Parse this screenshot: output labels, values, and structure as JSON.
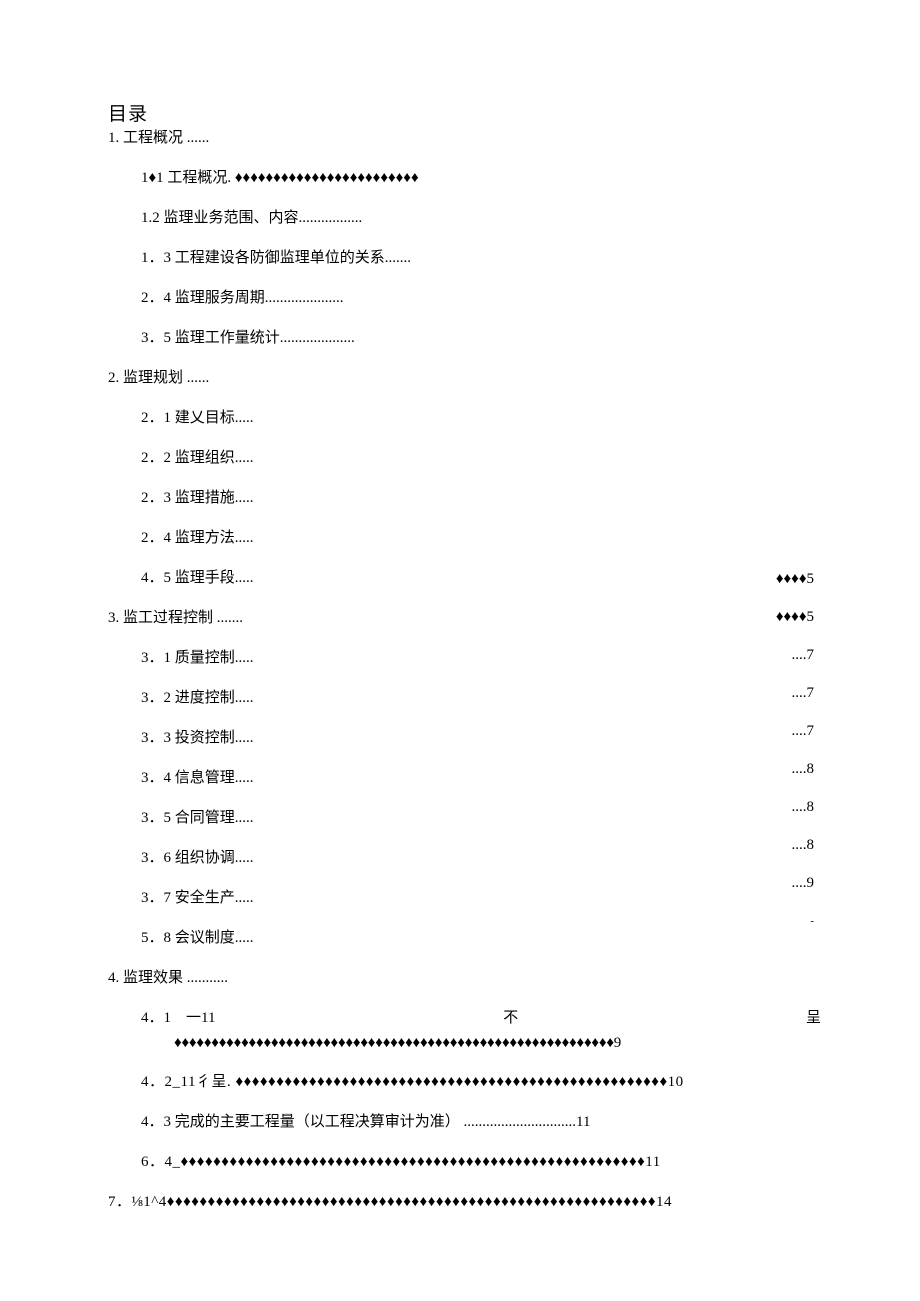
{
  "title": "目录",
  "s1": {
    "label": "1. 工程概况 ......"
  },
  "s1_1": {
    "label": "1♦1 工程概况. ♦♦♦♦♦♦♦♦♦♦♦♦♦♦♦♦♦♦♦♦♦♦♦♦"
  },
  "s1_2": {
    "label": "1.2 监理业务范围、内容................."
  },
  "s1_3": {
    "label": "1．3 工程建设各防御监理单位的关系......."
  },
  "s2_4": {
    "label": "2．4 监理服务周期....................."
  },
  "s3_5": {
    "label": "3．5 监理工作量统计...................."
  },
  "s2": {
    "label": "2. 监理规划 ......"
  },
  "s2_1": {
    "label": "2．1 建乂目标....."
  },
  "s2_2": {
    "label": "2．2 监理组织....."
  },
  "s2_3": {
    "label": "2．3 监理措施....."
  },
  "s2_4b": {
    "label": "2．4 监理方法....."
  },
  "s4_5": {
    "label": "4．5 监理手段....."
  },
  "s3": {
    "label": "3. 监工过程控制 ......."
  },
  "s3_1": {
    "label": "3．1 质量控制....."
  },
  "s3_2": {
    "label": "3．2 进度控制....."
  },
  "s3_3": {
    "label": "3．3 投资控制....."
  },
  "s3_4": {
    "label": "3．4 信息管理....."
  },
  "s3_5b": {
    "label": "3．5 合同管理....."
  },
  "s3_6": {
    "label": "3．6 组织协调....."
  },
  "s3_7": {
    "label": "3．7 安全生产....."
  },
  "s5_8": {
    "label": "5．8 会议制度....."
  },
  "s4": {
    "label": "4. 监理效果 ..........."
  },
  "s4_1a": {
    "a": "4．1　一11",
    "b": "不",
    "c": "呈"
  },
  "s4_1b": {
    "label": "♦♦♦♦♦♦♦♦♦♦♦♦♦♦♦♦♦♦♦♦♦♦♦♦♦♦♦♦♦♦♦♦♦♦♦♦♦♦♦♦♦♦♦♦♦♦♦♦♦♦♦♦♦♦♦♦♦♦♦9"
  },
  "s4_2": {
    "label": "4．2_11彳呈. ♦♦♦♦♦♦♦♦♦♦♦♦♦♦♦♦♦♦♦♦♦♦♦♦♦♦♦♦♦♦♦♦♦♦♦♦♦♦♦♦♦♦♦♦♦♦♦♦♦♦♦♦♦10"
  },
  "s4_3": {
    "label": "4．3 完成的主要工程量（以工程决算审计为准） ..............................11"
  },
  "s6_4": {
    "label": "6．4_♦♦♦♦♦♦♦♦♦♦♦♦♦♦♦♦♦♦♦♦♦♦♦♦♦♦♦♦♦♦♦♦♦♦♦♦♦♦♦♦♦♦♦♦♦♦♦♦♦♦♦♦♦♦♦♦♦11"
  },
  "s7": {
    "label": "7．⅛1^4♦♦♦♦♦♦♦♦♦♦♦♦♦♦♦♦♦♦♦♦♦♦♦♦♦♦♦♦♦♦♦♦♦♦♦♦♦♦♦♦♦♦♦♦♦♦♦♦♦♦♦♦♦♦♦♦♦♦♦♦14"
  },
  "right": {
    "r1": "♦♦♦♦5",
    "r2": "♦♦♦♦5",
    "r3": "....7",
    "r4": "....7",
    "r5": "....7",
    "r6": "....8",
    "r7": "....8",
    "r8": "....8",
    "r9": "....9",
    "r10": "-"
  }
}
